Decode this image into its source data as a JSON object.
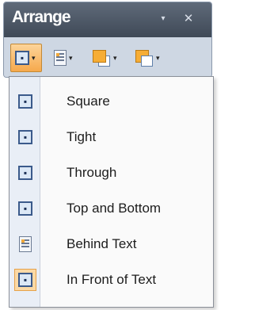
{
  "palette": {
    "title": "Arrange",
    "menu_glyph": "▾",
    "close_glyph": "✕"
  },
  "toolbar": {
    "caret": "▾",
    "wrap_glyph": "▪"
  },
  "menu": {
    "items": [
      {
        "label": "Square",
        "icon": "square-wrap-icon",
        "checked": false
      },
      {
        "label": "Tight",
        "icon": "tight-wrap-icon",
        "checked": false
      },
      {
        "label": "Through",
        "icon": "through-wrap-icon",
        "checked": false
      },
      {
        "label": "Top and Bottom",
        "icon": "top-bottom-wrap-icon",
        "checked": false
      },
      {
        "label": "Behind Text",
        "icon": "behind-text-icon",
        "checked": false
      },
      {
        "label": "In Front of Text",
        "icon": "in-front-text-icon",
        "checked": true
      }
    ]
  },
  "colors": {
    "title_bar": "#4f5a69",
    "pressed_button": "#f6a94c",
    "checked_item": "#fbd9a5"
  }
}
